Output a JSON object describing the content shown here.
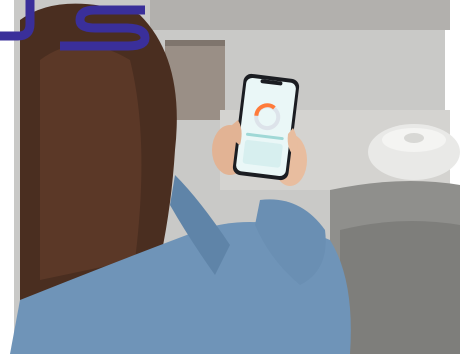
{
  "photo": {
    "logo_text": "JS",
    "colors": {
      "logo": "#3a2f9a",
      "wall": "#c9c9c7",
      "sofa": "#8f8f8c",
      "denim": "#6f94b8",
      "hair": "#4a2e20",
      "robot": "#e9e9e7",
      "screen_bg": "#eaf7f7",
      "gauge_accent": "#ff7b3a"
    }
  },
  "phone": {
    "screen_title": "",
    "gauge_value": ""
  }
}
